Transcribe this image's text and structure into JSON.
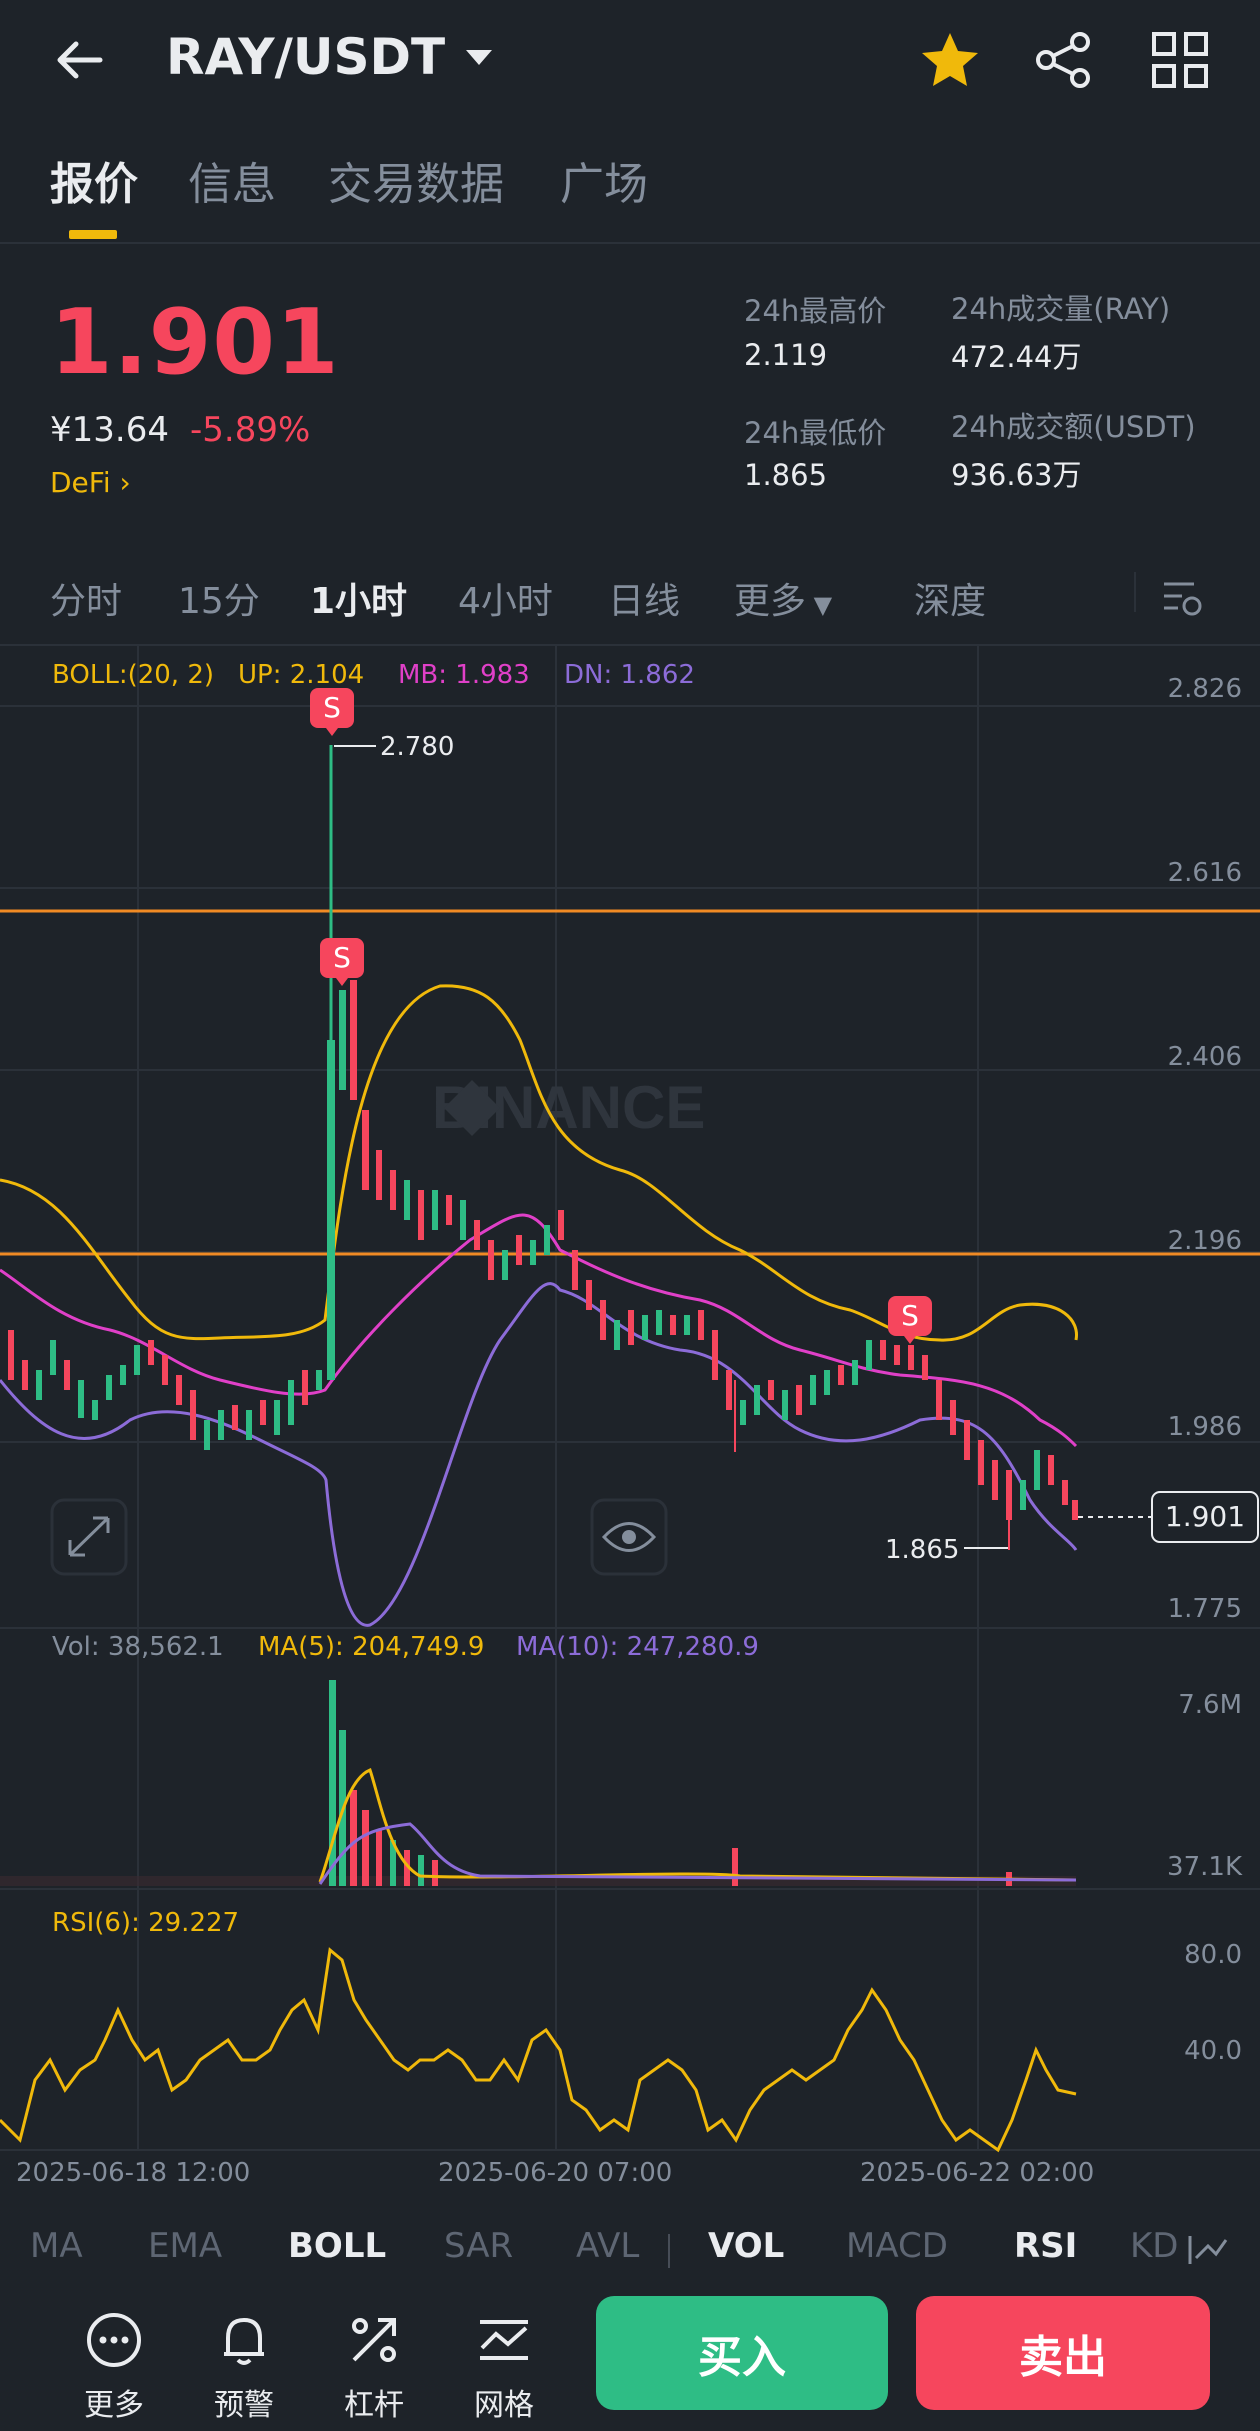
{
  "header": {
    "pair": "RAY/USDT",
    "icons": [
      "back-arrow-icon",
      "caret-down-icon",
      "star-icon",
      "share-icon",
      "grid-icon"
    ]
  },
  "tabs": [
    {
      "label": "报价",
      "active": true
    },
    {
      "label": "信息",
      "active": false
    },
    {
      "label": "交易数据",
      "active": false
    },
    {
      "label": "广场",
      "active": false
    }
  ],
  "ticker": {
    "price": "1.901",
    "cny": "¥13.64",
    "change": "-5.89%",
    "tag": "DeFi",
    "high_label": "24h最高价",
    "high": "2.119",
    "low_label": "24h最低价",
    "low": "1.865",
    "vol_base_label": "24h成交量(RAY)",
    "vol_base": "472.44万",
    "vol_quote_label": "24h成交额(USDT)",
    "vol_quote": "936.63万"
  },
  "intervals": [
    {
      "label": "分时",
      "active": false
    },
    {
      "label": "15分",
      "active": false
    },
    {
      "label": "1小时",
      "active": true
    },
    {
      "label": "4小时",
      "active": false
    },
    {
      "label": "日线",
      "active": false
    },
    {
      "label": "更多",
      "active": false
    },
    {
      "label": "深度",
      "active": false
    }
  ],
  "boll": {
    "label": "BOLL:(20, 2)",
    "up": "UP: 2.104",
    "mb": "MB: 1.983",
    "dn": "DN: 1.862"
  },
  "price_axis": [
    "2.826",
    "2.616",
    "2.406",
    "2.196",
    "1.986",
    "1.775"
  ],
  "markers": {
    "high": "2.780",
    "low": "1.865",
    "last": "1.901",
    "signal": "S"
  },
  "watermark": "BINANCE",
  "volume": {
    "vol": "Vol: 38,562.1",
    "ma5": "MA(5): 204,749.9",
    "ma10": "MA(10): 247,280.9",
    "axis": [
      "7.6M",
      "37.1K"
    ]
  },
  "rsi": {
    "label": "RSI(6): 29.227",
    "axis": [
      "80.0",
      "40.0"
    ]
  },
  "time_axis": [
    "2025-06-18 12:00",
    "2025-06-20 07:00",
    "2025-06-22 02:00"
  ],
  "indicator_tabs": [
    {
      "label": "MA",
      "on": false
    },
    {
      "label": "EMA",
      "on": false
    },
    {
      "label": "BOLL",
      "on": true
    },
    {
      "label": "SAR",
      "on": false
    },
    {
      "label": "AVL",
      "on": false
    },
    {
      "label": "VOL",
      "on": true
    },
    {
      "label": "MACD",
      "on": false
    },
    {
      "label": "RSI",
      "on": true
    },
    {
      "label": "KD",
      "on": false
    }
  ],
  "actions": [
    {
      "label": "更多",
      "icon": "more-icon"
    },
    {
      "label": "预警",
      "icon": "bell-icon"
    },
    {
      "label": "杠杆",
      "icon": "leverage-icon"
    },
    {
      "label": "网格",
      "icon": "grid-trading-icon"
    }
  ],
  "buy_label": "买入",
  "sell_label": "卖出",
  "colors": {
    "background": "#1e2329",
    "down": "#f6465d",
    "up": "#2ebd85",
    "accent": "#f0b90b",
    "boll_up_line": "#f0b90b",
    "boll_mb_line": "#e040c8",
    "boll_dn_line": "#8c6cd8"
  }
}
